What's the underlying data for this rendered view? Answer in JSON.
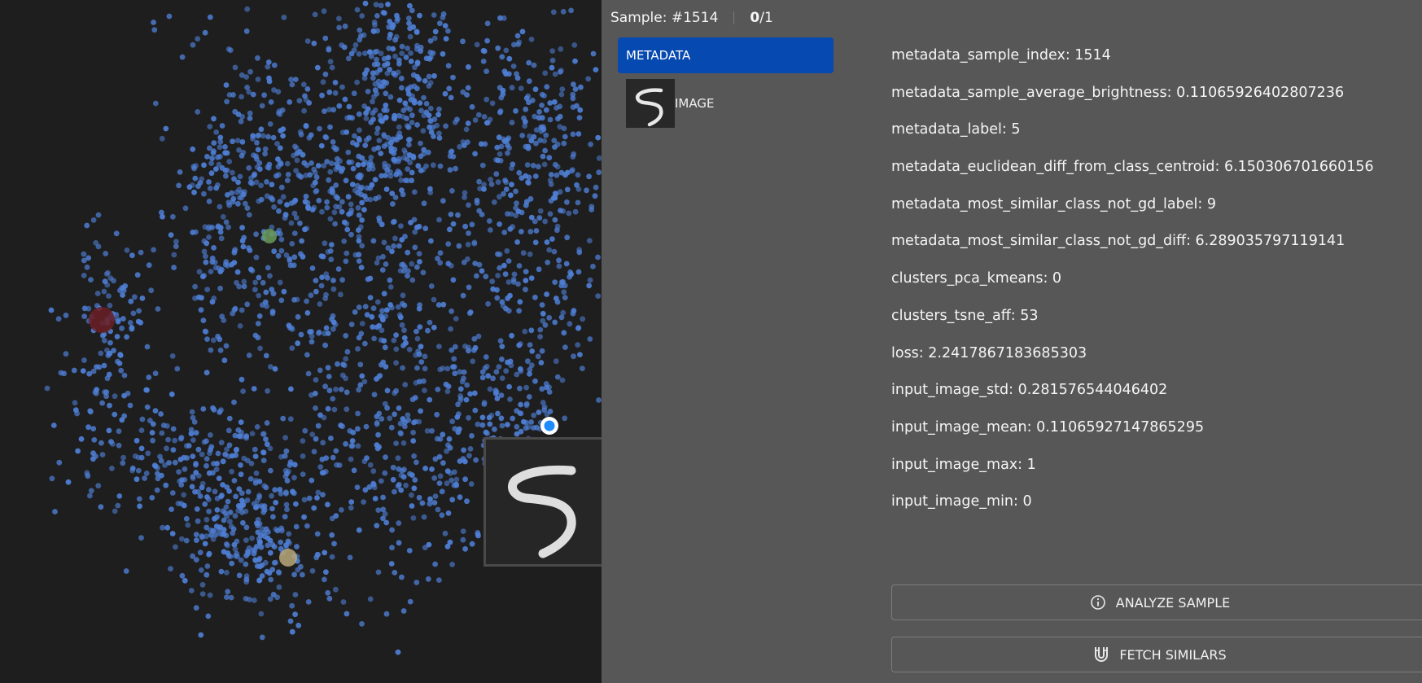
{
  "header": {
    "sample_label": "Sample: #1514",
    "count_current": "0",
    "count_total": "/1"
  },
  "tabs": [
    {
      "label": "METADATA",
      "active": true
    },
    {
      "label": "IMAGE",
      "active": false
    }
  ],
  "fields": [
    "metadata_sample_index: 1514",
    "metadata_sample_average_brightness: 0.11065926402807236",
    "metadata_label: 5",
    "metadata_euclidean_diff_from_class_centroid: 6.150306701660156",
    "metadata_most_similar_class_not_gd_label: 9",
    "metadata_most_similar_class_not_gd_diff: 6.289035797119141",
    "clusters_pca_kmeans: 0",
    "clusters_tsne_aff: 53",
    "loss: 2.2417867183685303",
    "input_image_std: 0.281576544046402",
    "input_image_mean: 0.11065927147865295",
    "input_image_max: 1",
    "input_image_min: 0"
  ],
  "buttons": {
    "analyze": {
      "label": "ANALYZE SAMPLE",
      "icon": "info-icon"
    },
    "fetch": {
      "label": "FETCH SIMILARS",
      "icon": "magnet-icon"
    }
  },
  "colors": {
    "point": "#4f7fd6",
    "selected": "#1e8bff",
    "tab_active": "#0649b0",
    "panel_bg": "#575757",
    "plot_bg": "#1e1e1e"
  }
}
